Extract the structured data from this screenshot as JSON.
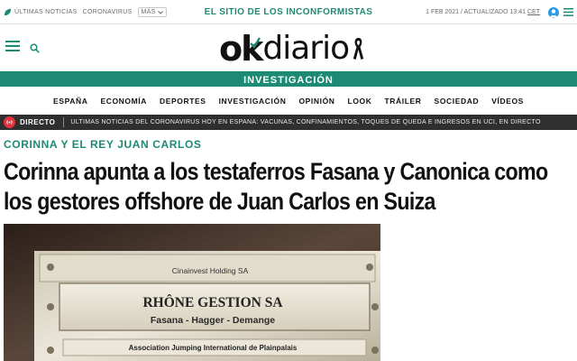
{
  "topbar": {
    "links": [
      "Últimas noticias",
      "Coronavirus"
    ],
    "more_label": "MÁS",
    "slogan": "EL SITIO DE LOS INCONFORMISTAS",
    "date": "1 FEB 2021 / ACTUALIZADO 13:41",
    "timezone": "CET"
  },
  "logo": {
    "ok": "ok",
    "diario": "diario"
  },
  "section": "INVESTIGACIÓN",
  "nav": [
    "ESPAÑA",
    "ECONOMÍA",
    "DEPORTES",
    "INVESTIGACIÓN",
    "OPINIÓN",
    "LOOK",
    "TRÁILER",
    "SOCIEDAD",
    "VÍDEOS"
  ],
  "live": {
    "label": "DIRECTO",
    "ticker": "ÚLTIMAS NOTICIAS DEL CORONAVIRUS HOY EN ESPAÑA: VACUNAS, CONFINAMIENTOS, TOQUES DE QUEDA E INGRESOS EN UCI, EN DIRECTO"
  },
  "article": {
    "kicker": "CORINNA Y EL REY JUAN CARLOS",
    "headline": "Corinna apunta a los testaferros Fasana y Canonica como los gestores offshore de Juan Carlos en Suiza"
  },
  "photo": {
    "plate_top": "Cinainvest Holding SA",
    "plate_main_title": "RHÔNE GESTION SA",
    "plate_main_names": "Fasana - Hagger - Demange",
    "plate_bottom": "Association Jumping International de Plainpalais"
  },
  "colors": {
    "brand": "#1d8a74",
    "live_red": "#e0353c",
    "live_bar": "#2f2f2f"
  }
}
